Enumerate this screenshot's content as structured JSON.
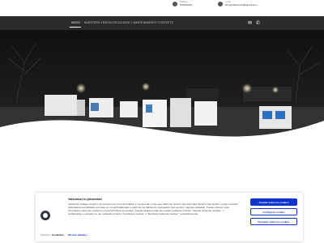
{
  "topbar": {
    "phone": {
      "label": "Teléfono",
      "value": "675942234"
    },
    "email": {
      "label": "e-mail",
      "value": "amigosdelmercat@gmail.com"
    }
  },
  "nav": {
    "items": [
      {
        "label": "INICIO",
        "active": true
      },
      {
        "label": "NUESTROS VEHÍCULOS"
      },
      {
        "label": "CALIDAD Y MANTENIMIENTO"
      },
      {
        "label": "CONTACTO"
      }
    ],
    "icons": [
      "email-icon",
      "phone-icon"
    ]
  },
  "hero": {
    "description": "Night photo of parked white mobile vehicles under street lights",
    "colors": {
      "sky": "#161616",
      "ground": "#3a3a3a",
      "wave": "#ffffff"
    }
  },
  "cookie_banner": {
    "title": "Valoramos tu privacidad",
    "text": "Utilizamos cookies propias y de terceros con el fin de analizar y comprender el uso que haces de nuestro sitio web para hacerlo más intuitivo y para mostrarte publicidad personalizada con base en un perfil elaborado a partir de tus hábitos de navegación (por ejemplo, páginas visitadas). Puedes obtener más información sobre las cookies en nuestra Política de Cookies. Puedes aceptar todas las cookies pulsando el botón \"Aceptar todas las cookies\", o configurarlas o rechazar su uso pulsando el botón \"Configurar cookies\" o \"Rechazar todas las cookies\", respectivamente.",
    "buttons": {
      "accept_all": "Aceptar todas las cookies",
      "configure": "Configurar cookies",
      "reject_all": "Rechazar todas las cookies"
    },
    "details_link": "Mostrar detalles",
    "powered_by": "Powered by",
    "brand": "Cookiebot",
    "brand_sub": "by Usercentrics",
    "accent_color": "#1032cf"
  }
}
